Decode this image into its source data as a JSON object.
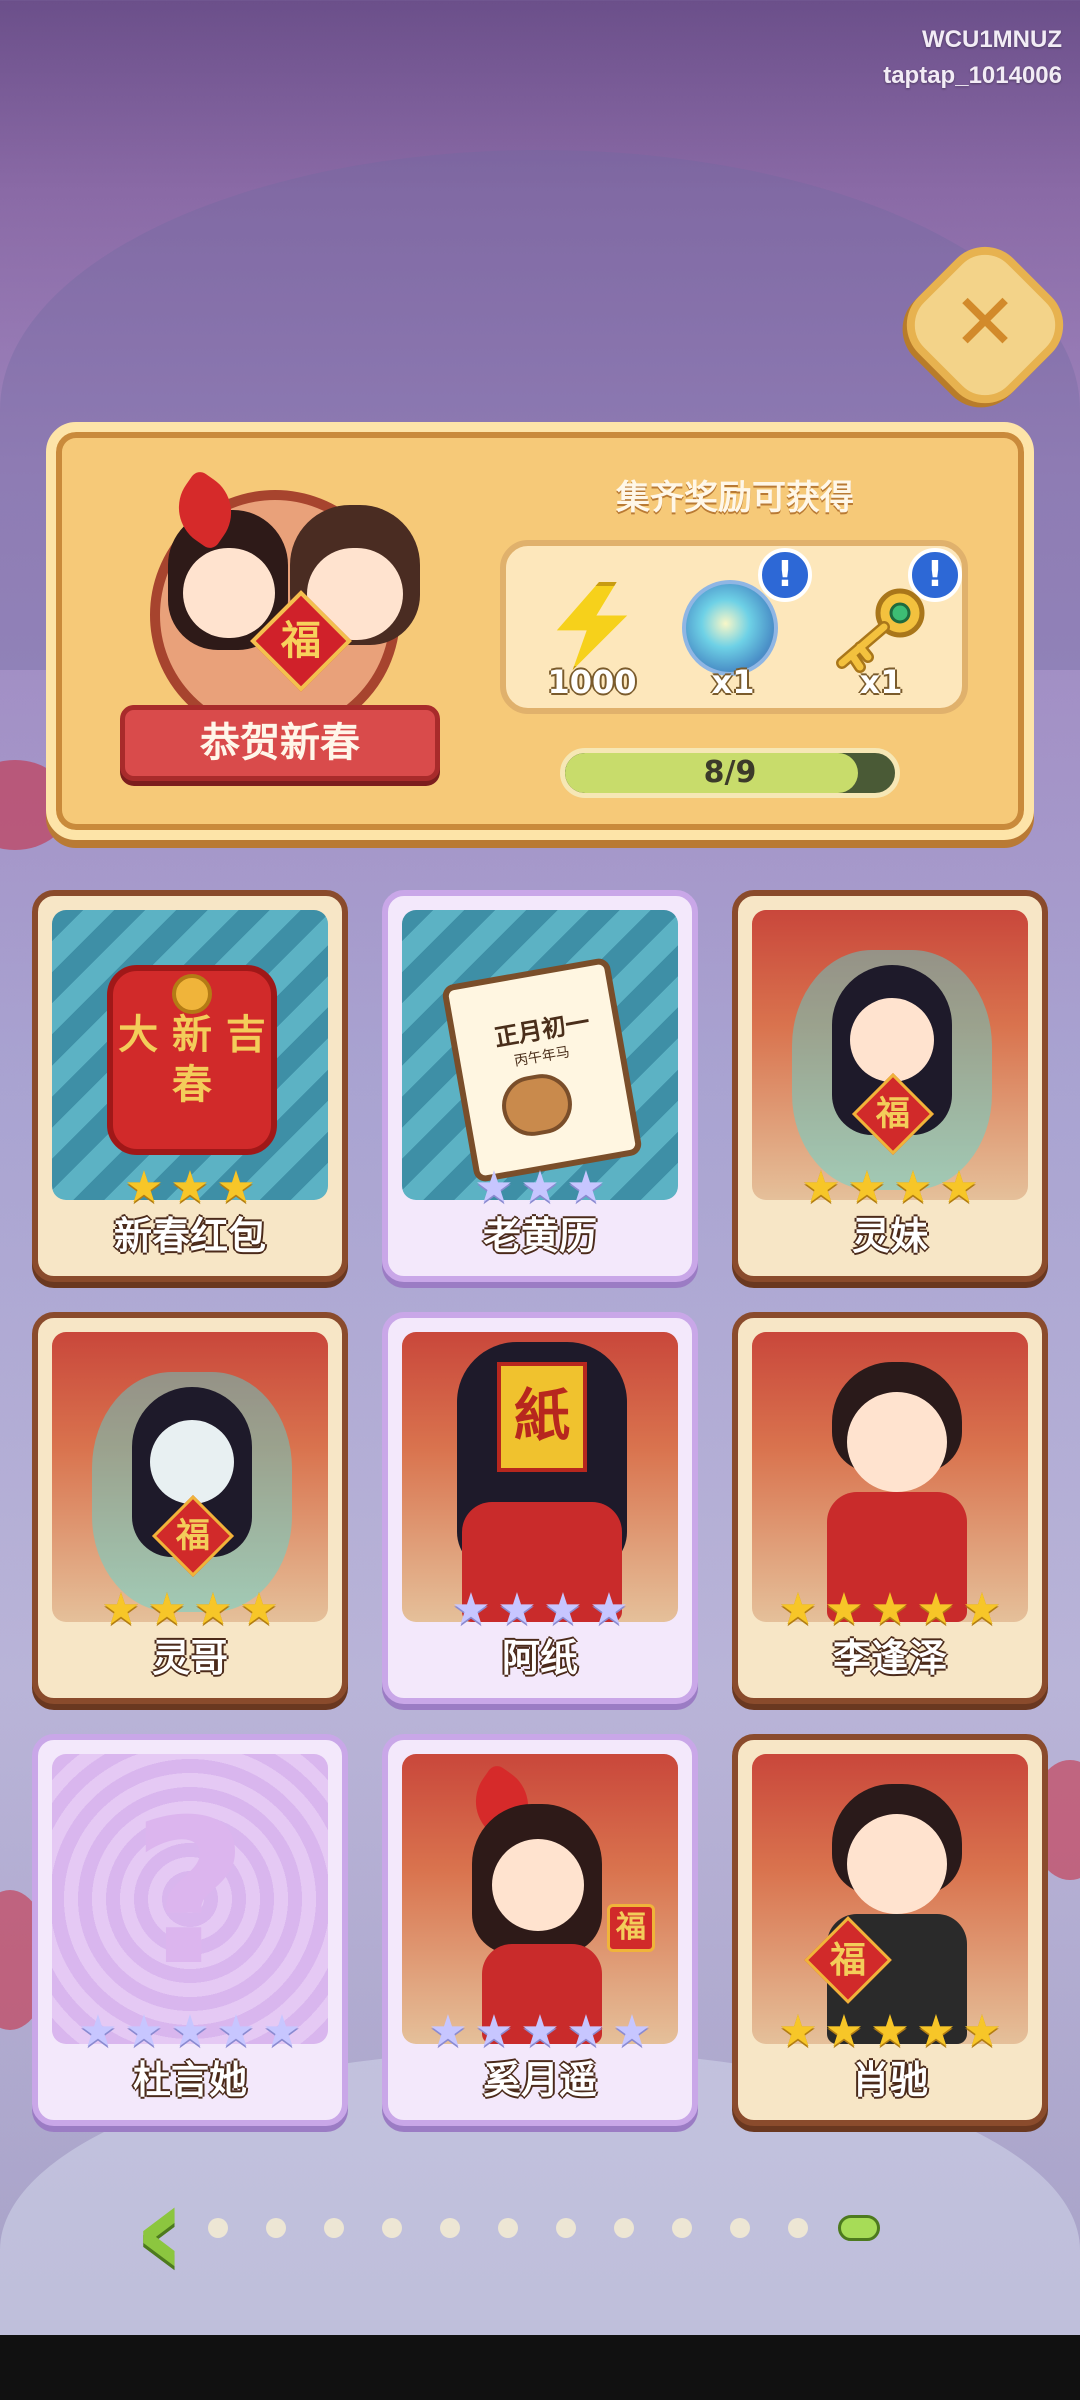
{
  "watermark": {
    "line1": "WCU1MNUZ",
    "line2": "taptap_1014006"
  },
  "close_button": {
    "icon": "close-x-icon",
    "glyph": "✕"
  },
  "event_panel": {
    "title": "恭贺新春",
    "reward_title": "集齐奖励可获得",
    "rewards": [
      {
        "icon": "lightning-energy-icon",
        "count": "1000"
      },
      {
        "icon": "magic-orb-icon",
        "count": "x1",
        "alert": "!"
      },
      {
        "icon": "golden-key-icon",
        "count": "x1",
        "alert": "!"
      }
    ],
    "progress": {
      "text": "8/9",
      "fraction": 0.8889
    }
  },
  "cards": [
    {
      "name": "新春红包",
      "rarity": "gold",
      "stars": 3,
      "art": "red-envelope",
      "envelope_text": "大 新 吉\n春",
      "purple": false
    },
    {
      "name": "老黄历",
      "rarity": "pastel",
      "stars": 3,
      "art": "calendar",
      "calendar_title": "正月初一",
      "calendar_sub": "丙午年马",
      "purple": true
    },
    {
      "name": "灵妹",
      "rarity": "gold",
      "stars": 4,
      "art": "ghost-girl",
      "fu": "福",
      "purple": false
    },
    {
      "name": "灵哥",
      "rarity": "gold",
      "stars": 4,
      "art": "ghost-boy",
      "fu": "福",
      "purple": false
    },
    {
      "name": "阿纸",
      "rarity": "pastel",
      "stars": 4,
      "art": "paper-man",
      "paper": "紙",
      "purple": true
    },
    {
      "name": "李逢泽",
      "rarity": "gold",
      "stars": 5,
      "art": "man-red",
      "purple": false
    },
    {
      "name": "杜言她",
      "rarity": "pastel",
      "stars": 5,
      "art": "locked",
      "question": "?",
      "purple": true
    },
    {
      "name": "奚月遥",
      "rarity": "pastel",
      "stars": 5,
      "art": "girl-red",
      "fu": "福",
      "purple": true
    },
    {
      "name": "肖驰",
      "rarity": "gold",
      "stars": 5,
      "art": "man-fu",
      "fu": "福",
      "purple": false
    }
  ],
  "pagination": {
    "prev_glyph": "‹",
    "total_pages": 12,
    "active_index": 11
  },
  "colors": {
    "panel": "#f6c978",
    "progress_fill": "#c8dc6b",
    "gold_star": "#f7c628",
    "pastel_star": "#c7c6ff",
    "accent_red": "#d12a2a"
  }
}
